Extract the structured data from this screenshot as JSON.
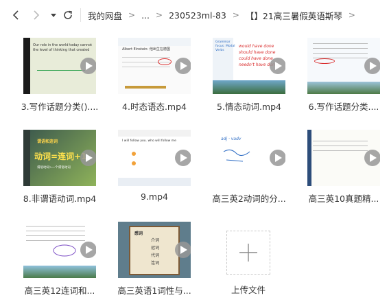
{
  "nav": {
    "back_icon": "chevron-left-icon",
    "forward_icon": "chevron-right-icon",
    "history_icon": "caret-down-icon",
    "refresh_icon": "refresh-icon"
  },
  "breadcrumb": {
    "items": [
      "我的网盘",
      "...",
      "230523ml-83",
      "【】21高三暑假英语斯琴"
    ],
    "separator": ">"
  },
  "files": [
    {
      "name": "3.写作话题分类()....",
      "type": "video"
    },
    {
      "name": "4.时态语态.mp4",
      "type": "video"
    },
    {
      "name": "5.情态动词.mp4",
      "type": "video"
    },
    {
      "name": "6.写作话题分类....",
      "type": "video"
    },
    {
      "name": "8.非谓语动词.mp4",
      "type": "video"
    },
    {
      "name": "9.mp4",
      "type": "video"
    },
    {
      "name": "高三英2动词的分...",
      "type": "video"
    },
    {
      "name": "高三英10真题精...",
      "type": "video"
    },
    {
      "name": "高三英12连词和...",
      "type": "video"
    },
    {
      "name": "高三英语1词性与...",
      "type": "video"
    }
  ],
  "upload": {
    "label": "上传文件",
    "icon": "plus-icon"
  },
  "thumb_text": {
    "t1_line1": "Our role in the world today cannot",
    "t1_line2": "the level of thinking that created",
    "t2_line1": "Albert Einstein: 他出生在德国",
    "t3_line1": "Grammar focus: Modal Verbs",
    "t3_hand1": "would have done",
    "t3_hand2": "should have done",
    "t3_hand3": "could have done",
    "t3_hand4": "needn't have done",
    "t5_line1": "谓语和连词",
    "t5_big": "动词=连词+1",
    "t5_line3": "谓语动词>一个谓语动词",
    "t6_line1": "I will follow you. who will follow me",
    "t7_hand": "adj · vadv",
    "t10_col1": "感词",
    "t10_w1": "介词",
    "t10_w2": "冠词",
    "t10_w3": "代词",
    "t10_w4": "连词"
  },
  "colors": {
    "accent_red": "#d92b2b",
    "accent_blue": "#2d6cc4"
  }
}
